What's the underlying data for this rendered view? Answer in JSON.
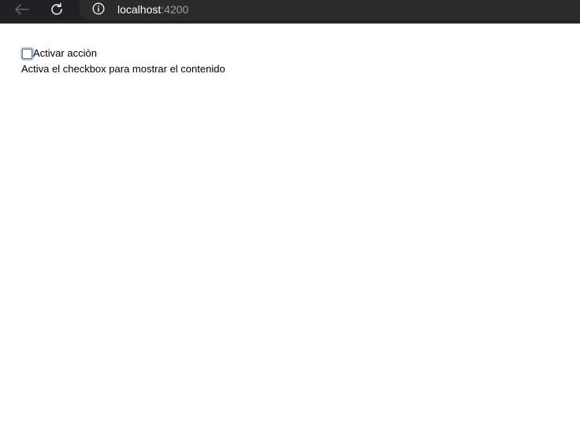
{
  "browser": {
    "url_host": "localhost",
    "url_port": ":4200"
  },
  "page": {
    "checkbox_label": "Activar acciòn",
    "checkbox_checked": false,
    "message": "Activa el checkbox para mostrar el contenido"
  }
}
